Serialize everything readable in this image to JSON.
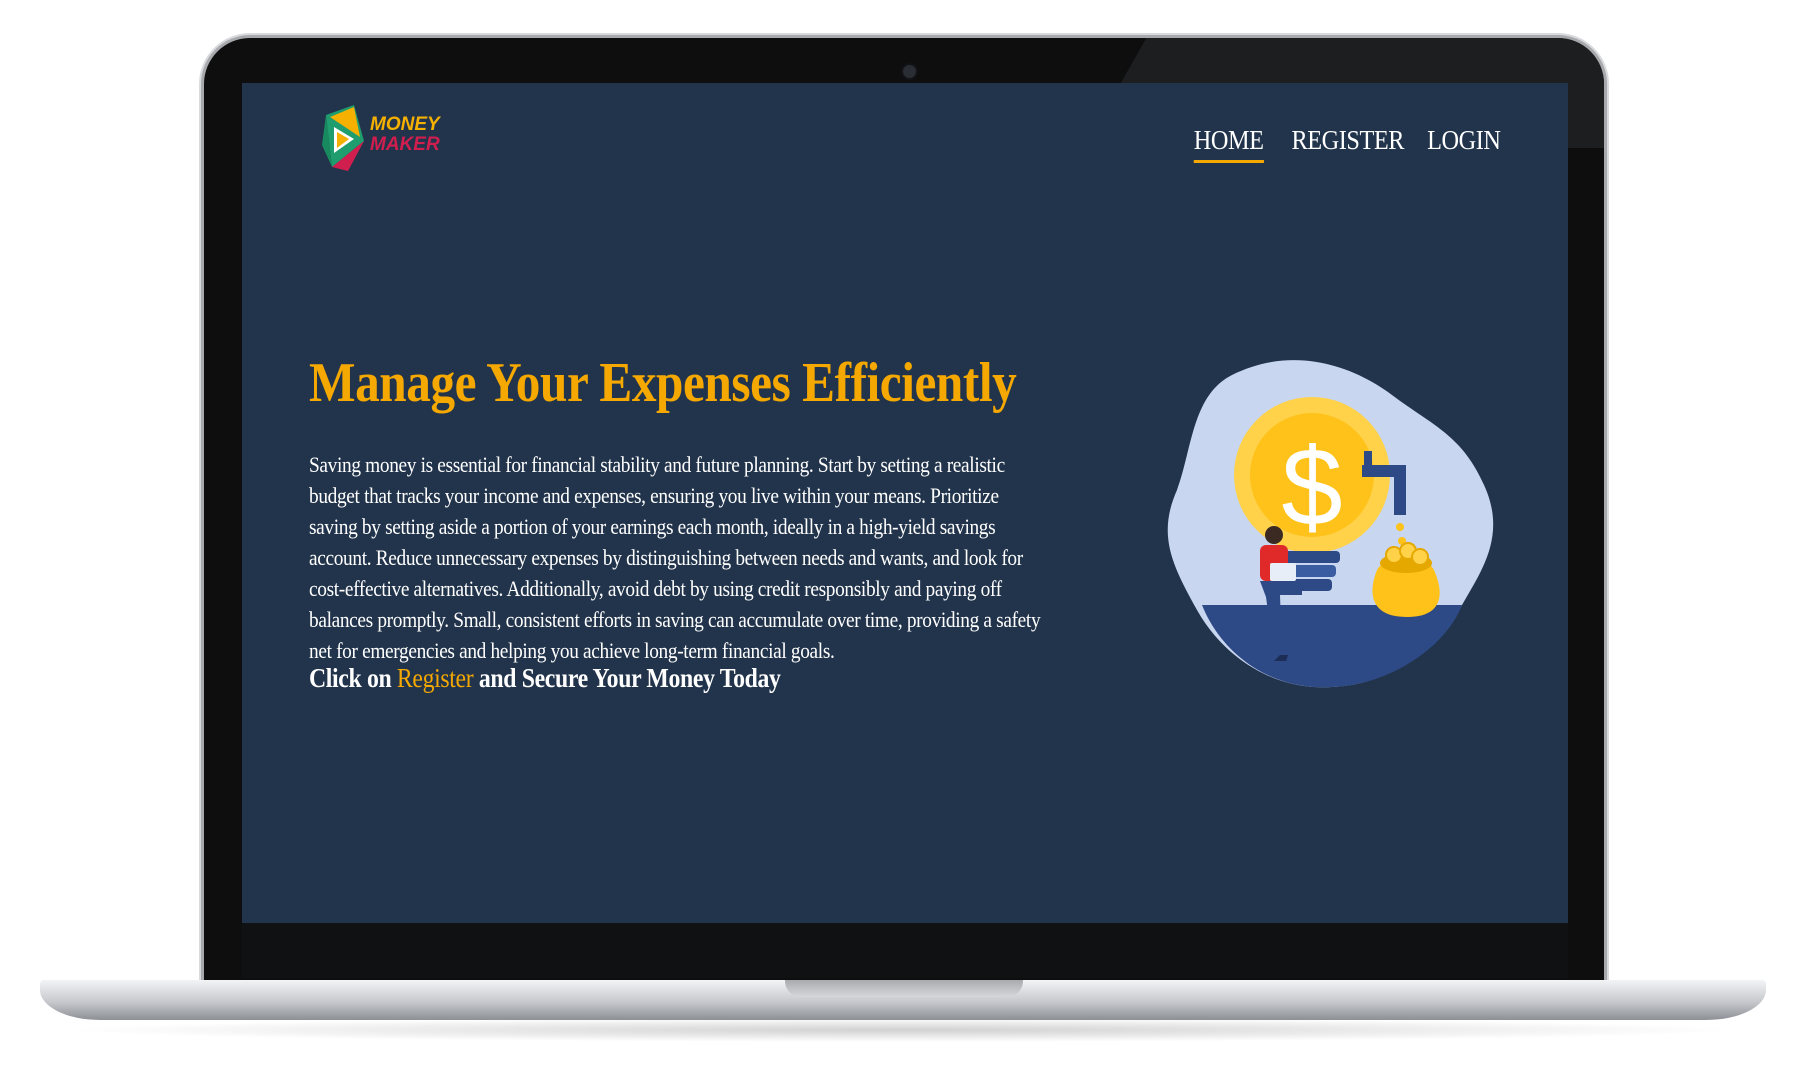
{
  "brand": {
    "logo_line1": "MONEY",
    "logo_line2": "MAKER",
    "colors": {
      "accent": "#f5a800",
      "logo_red": "#d01e4f",
      "background": "#22344b",
      "text": "#ffffff"
    }
  },
  "nav": {
    "items": [
      {
        "label": "HOME",
        "active": true
      },
      {
        "label": "REGISTER",
        "active": false
      },
      {
        "label": "LOGIN",
        "active": false
      }
    ]
  },
  "hero": {
    "title": "Manage Your Expenses Efficiently",
    "body": "Saving money is essential for financial stability and future planning. Start by setting a realistic budget that tracks your income and expenses, ensuring you live within your means. Prioritize saving by setting aside a portion of your earnings each month, ideally in a high-yield savings account. Reduce unnecessary expenses by distinguishing between needs and wants, and look for cost-effective alternatives. Additionally, avoid debt by using credit responsibly and paying off balances promptly. Small, consistent efforts in saving can accumulate over time, providing a safety net for emergencies and helping you achieve long-term financial goals.",
    "cta_prefix": "Click on ",
    "cta_link": "Register",
    "cta_suffix": " and Secure Your Money Today",
    "illustration_icon": "money-lightbulb-illustration"
  }
}
